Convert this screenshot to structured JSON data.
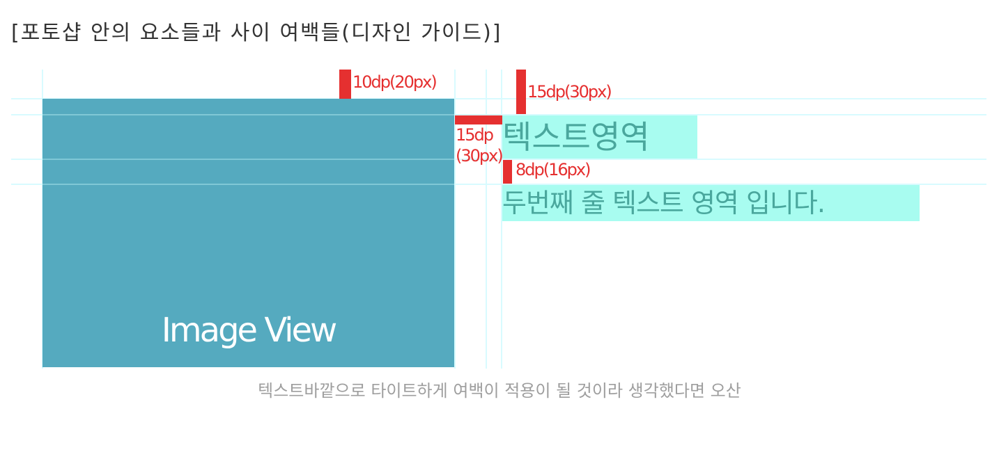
{
  "title": "[포토샵 안의 요소들과 사이 여백들(디자인 가이드)]",
  "figure": {
    "image_view_label": "Image View",
    "text_area_1": "텍스트영역",
    "text_area_2": "두번째 줄 텍스트 영역 입니다.",
    "dimensions": {
      "top_margin": "10dp(20px)",
      "text_top_margin": "15dp(30px)",
      "left_gap_line1": "15dp",
      "left_gap_line2": "(30px)",
      "line_gap": "8dp(16px)"
    },
    "colors": {
      "image_view": "#55aabf",
      "marker": "#e53030",
      "text_highlight": "#a8fcf0",
      "guide": "#d8fbff"
    }
  },
  "caption": "텍스트바깥으로 타이트하게 여백이 적용이 될 것이라 생각했다면 오산"
}
